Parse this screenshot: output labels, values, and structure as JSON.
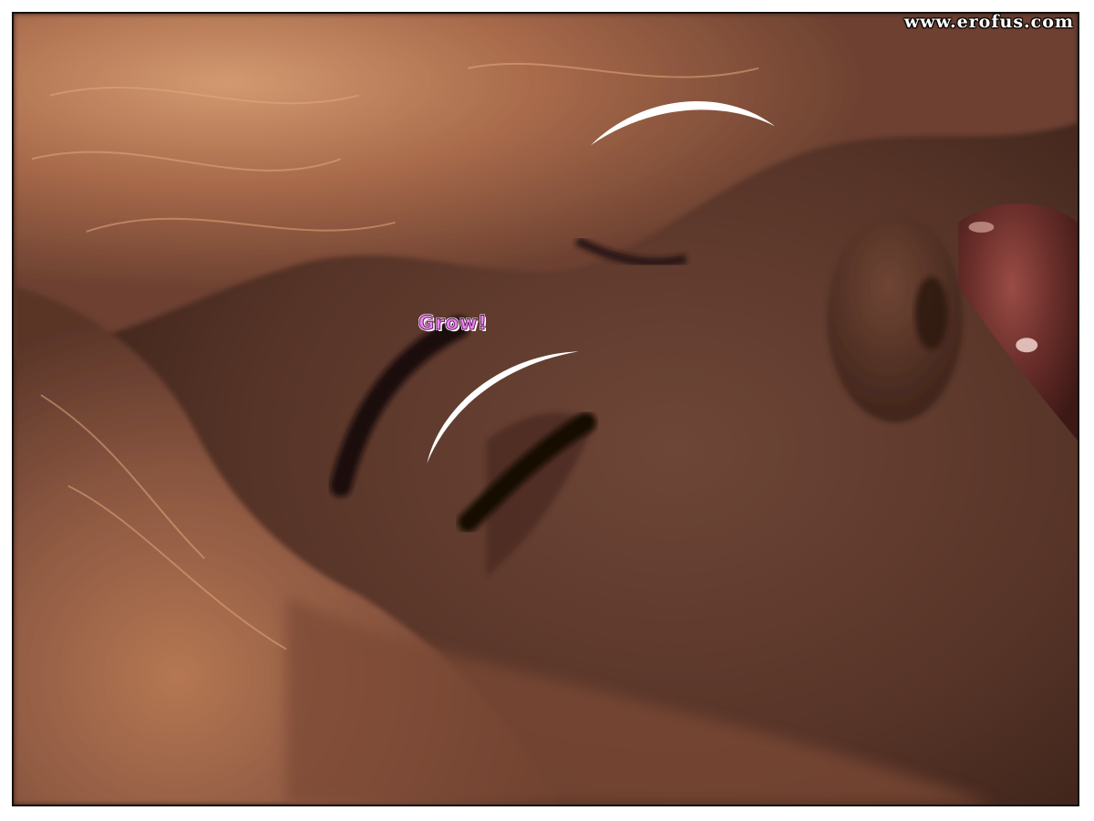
{
  "watermark": {
    "text": "www.erofus.com"
  },
  "panel": {
    "sfx_text": "Grow!"
  },
  "colors": {
    "frame": "#111111",
    "hair_light": "#c9865a",
    "hair_dark": "#7a4a32",
    "skin": "#6b4334",
    "skin_dark": "#3c2219",
    "lips": "#6a2e2a",
    "motion_arc": "#ffffff",
    "sfx_fill": "#ee82ee"
  },
  "icons": {
    "motion_arc_upper": "motion-arc",
    "motion_arc_lower": "motion-arc"
  }
}
